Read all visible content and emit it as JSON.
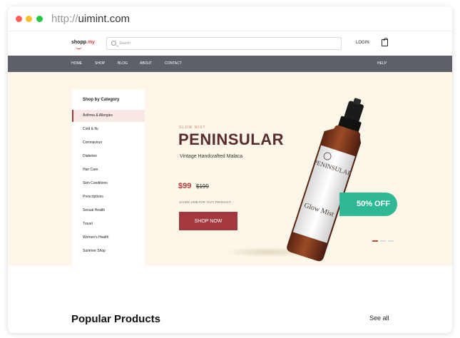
{
  "browser": {
    "url_protocol": "http://",
    "url_domain": "uimint.com"
  },
  "header": {
    "logo_name": "shopp",
    "logo_suffix": ".my",
    "search_placeholder": "Search",
    "login_label": "LOGIN",
    "cart_icon": "cart-icon"
  },
  "nav": {
    "items": [
      "HOME",
      "SHOP",
      "BLOG",
      "ABOUT",
      "CONTACT"
    ],
    "help": "HELP"
  },
  "sidebar": {
    "title": "Shop by Category",
    "items": [
      "Asthma & Allergies",
      "Cold & flu",
      "Coronavirus",
      "Diabetes",
      "Hair Care",
      "Skin Conditions",
      "Prescriptions",
      "Sexual Health",
      "Travel",
      "Women's Health",
      "Summer Shop"
    ],
    "active_index": 0
  },
  "hero": {
    "tagline": "GLOW MIST",
    "headline": "PENINSULAR",
    "subline": "Vintage Handcrafted Malaca",
    "price": "$99",
    "old_price": "$199",
    "saved_text": "SAVED 100$ FOR THAT PRODUCT",
    "cta_label": "SHOP NOW",
    "discount_badge": "50% OFF",
    "bottle_brand": "PENINSULAR",
    "bottle_product": "Glow Mist",
    "colors": {
      "accent": "#a3383e",
      "badge": "#2fb894",
      "hero_bg": "#fcf7e8",
      "nav_bg": "#5d6069"
    }
  },
  "popular": {
    "title": "Popular Products",
    "see_all": "See all"
  }
}
